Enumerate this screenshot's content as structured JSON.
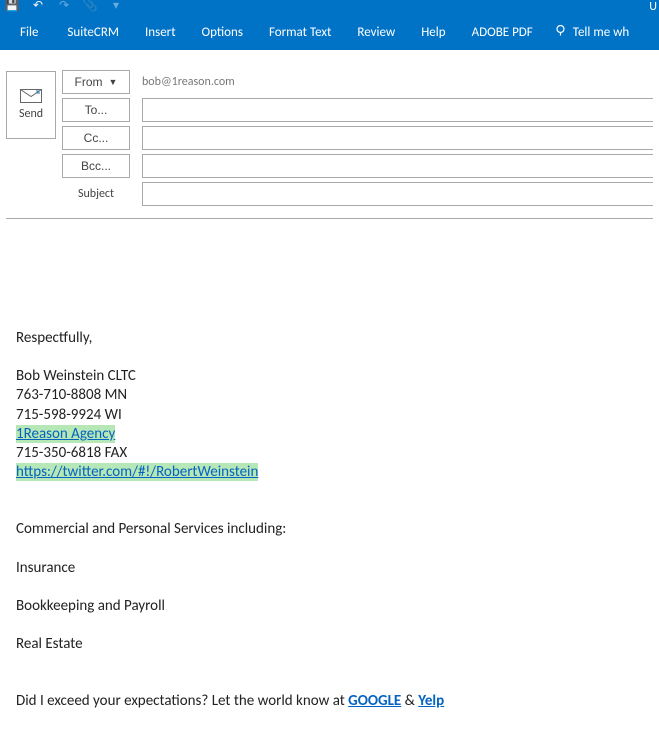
{
  "qat": {
    "save_icon": "💾",
    "undo_icon": "↶",
    "redo_icon": "↷",
    "attach_icon": "📎",
    "dd_icon": "▾",
    "right_text": "U"
  },
  "tabs": {
    "file": "File",
    "items": [
      "SuiteCRM",
      "Insert",
      "Options",
      "Format Text",
      "Review",
      "Help",
      "ADOBE PDF"
    ],
    "tellme": "Tell me wh"
  },
  "header": {
    "send": "Send",
    "from_label": "From",
    "from_value": "bob@1reason.com",
    "to_label": "To...",
    "cc_label": "Cc...",
    "bcc_label": "Bcc...",
    "subject_label": "Subject"
  },
  "body": {
    "respect": "Respectfully,",
    "name": "Bob Weinstein CLTC",
    "phone_mn": "763-710-8808 MN",
    "phone_wi": "715-598-9924 WI",
    "agency": "1Reason Agency",
    "fax": "715-350-6818 FAX",
    "twitter": "https://twitter.com/#!/RobertWeinstein",
    "services_head": "Commercial and Personal Services including:",
    "svc1": "Insurance",
    "svc2": "Bookkeeping and Payroll",
    "svc3": "Real Estate",
    "exceed_pre": "Did I exceed your expectations? Let the world know at ",
    "google": "GOOGLE",
    "amp": " & ",
    "yelp": "Yelp"
  }
}
